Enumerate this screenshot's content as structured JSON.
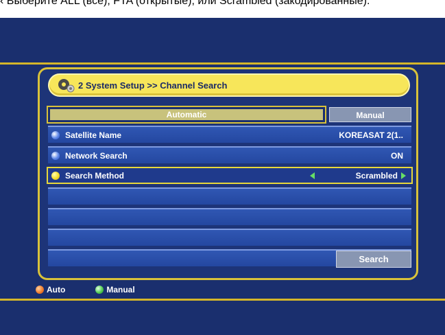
{
  "caption": "‹ Выберите ALL (все), FTA (открытые), или Scrambled (закодированные).",
  "title": "2  System Setup >> Channel Search",
  "tabs": {
    "automatic": "Automatic",
    "manual": "Manual"
  },
  "rows": [
    {
      "label": "Satellite Name",
      "value": "KOREASAT 2(1.."
    },
    {
      "label": "Network Search",
      "value": "ON"
    },
    {
      "label": "Search Method",
      "value": "Scrambled"
    }
  ],
  "search_button": "Search",
  "legend": {
    "auto": "Auto",
    "manual": "Manual"
  },
  "colors": {
    "background": "#1a2f6e",
    "accent": "#f7e65a",
    "row": "#2447a0"
  }
}
